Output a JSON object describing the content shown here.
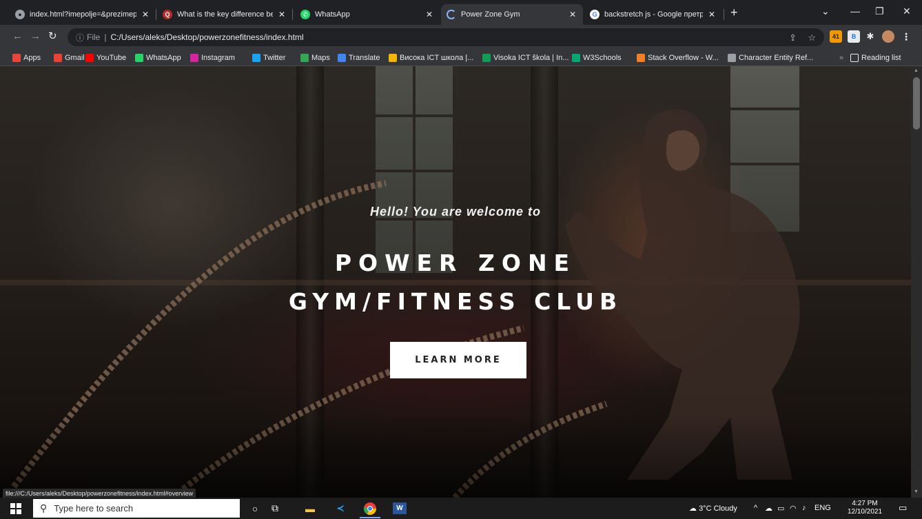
{
  "browser": {
    "tabs": [
      {
        "title": "index.html?imepolje=&prezimep",
        "icon": "globe-icon"
      },
      {
        "title": "What is the key difference betwe",
        "icon": "quora-icon"
      },
      {
        "title": "WhatsApp",
        "icon": "whatsapp-icon"
      },
      {
        "title": "Power Zone Gym",
        "icon": "loading-icon",
        "active": true
      },
      {
        "title": "backstretch js - Google претрага",
        "icon": "google-icon"
      }
    ],
    "address": {
      "scheme_label": "File",
      "url": "C:/Users/aleks/Desktop/powerzonefitness/index.html"
    },
    "bookmarks": [
      {
        "label": "Apps",
        "color": "#e8453c"
      },
      {
        "label": "Gmail",
        "color": "#ea4335"
      },
      {
        "label": "YouTube",
        "color": "#ff0000"
      },
      {
        "label": "WhatsApp",
        "color": "#25d366"
      },
      {
        "label": "Instagram",
        "color": "#d6249f"
      },
      {
        "label": "Twitter",
        "color": "#1da1f2"
      },
      {
        "label": "Maps",
        "color": "#34a853"
      },
      {
        "label": "Translate",
        "color": "#4285f4"
      },
      {
        "label": "Висока ICT школа |...",
        "color": "#f4b400"
      },
      {
        "label": "Visoka ICT škola | In...",
        "color": "#0f9d58"
      },
      {
        "label": "W3Schools",
        "color": "#04aa6d"
      },
      {
        "label": "Stack Overflow - W...",
        "color": "#f48024"
      },
      {
        "label": "Character Entity Ref...",
        "color": "#9aa0a6"
      }
    ],
    "bookmarks_overflow": "»",
    "reading_list": "Reading list",
    "extension_badge": "41",
    "status_url": "file:///C:/Users/aleks/Desktop/powerzonefitness/index.html#overview"
  },
  "hero": {
    "greeting": "Hello! You are welcome to",
    "title_line1": "POWER ZONE",
    "title_line2": "GYM/FITNESS CLUB",
    "button_label": "LEARN MORE"
  },
  "taskbar": {
    "search_placeholder": "Type here to search",
    "weather": "3°C  Cloudy",
    "language": "ENG",
    "time": "4:27 PM",
    "date": "12/10/2021"
  }
}
